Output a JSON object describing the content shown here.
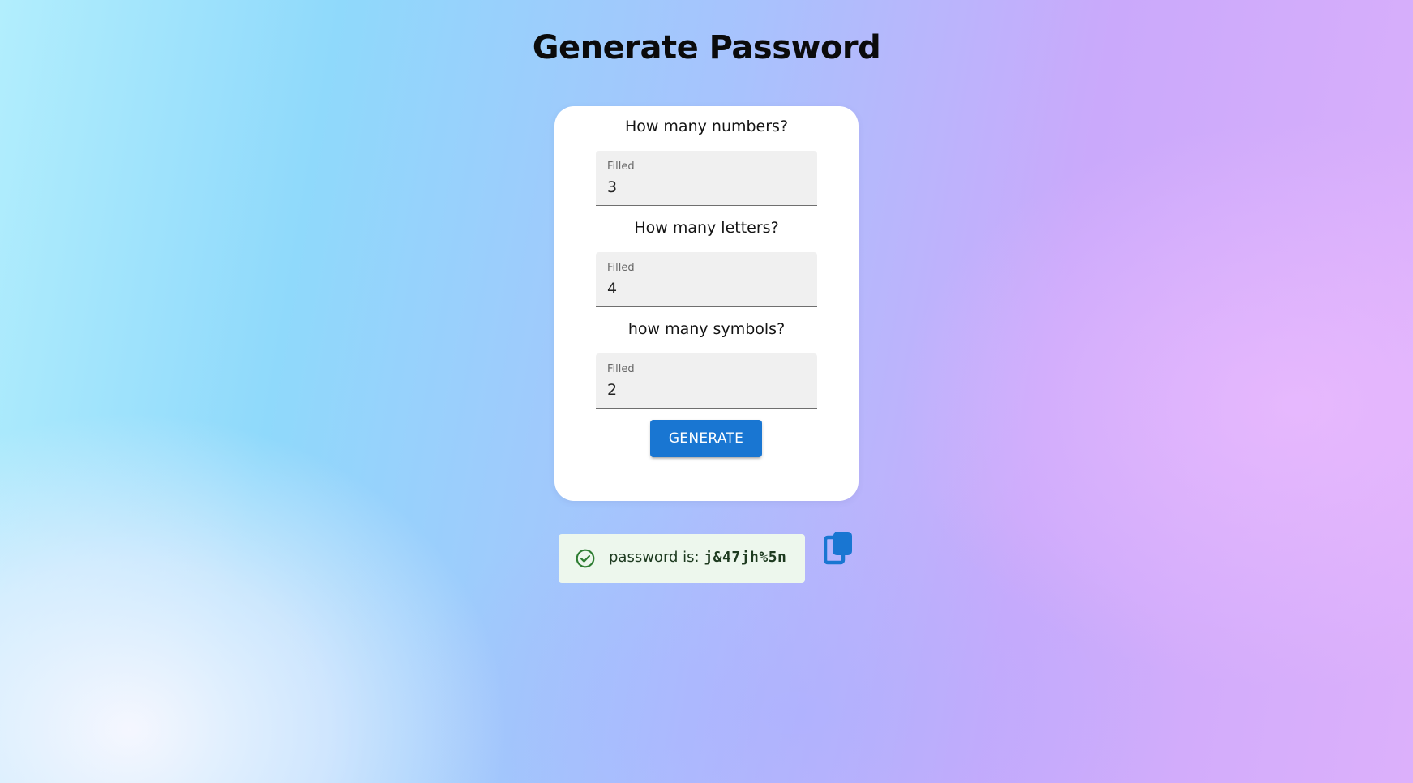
{
  "page": {
    "title": "Generate Password"
  },
  "form": {
    "numbers": {
      "question": "How many numbers?",
      "label": "Filled",
      "value": "3"
    },
    "letters": {
      "question": "How many letters?",
      "label": "Filled",
      "value": "4"
    },
    "symbols": {
      "question": "how many symbols?",
      "label": "Filled",
      "value": "2"
    },
    "generate_label": "GENERATE"
  },
  "result": {
    "prefix": "password is: ",
    "password": "j&47jh%5n",
    "icon": "check-circle-icon",
    "copy_icon": "copy-icon"
  },
  "colors": {
    "primary": "#1976d2",
    "success_bg": "#edf7ed",
    "success_icon": "#2e7d32",
    "success_text": "#1e3b20",
    "field_bg": "#f0f0f0"
  }
}
